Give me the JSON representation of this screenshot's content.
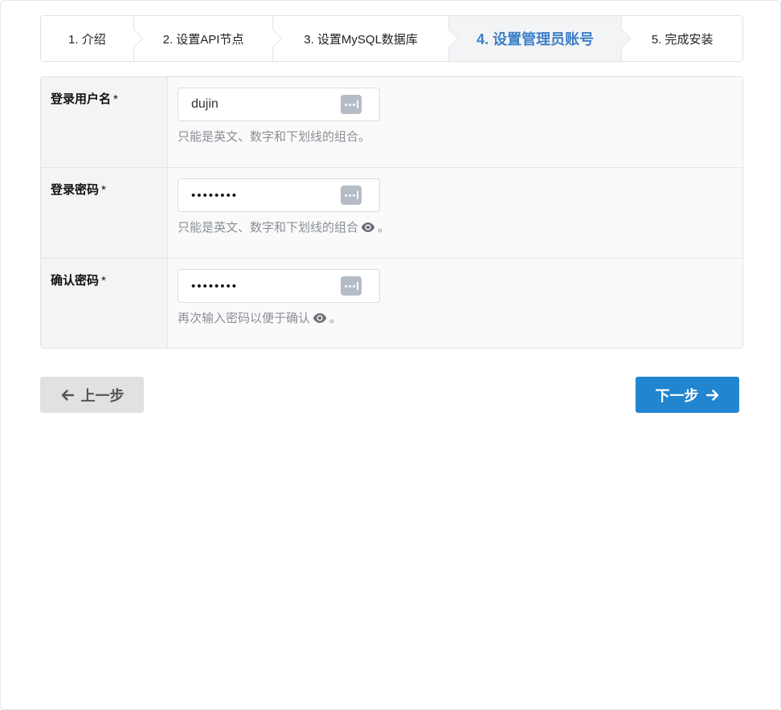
{
  "steps": [
    {
      "label": "1. 介绍"
    },
    {
      "label": "2. 设置API节点"
    },
    {
      "label": "3. 设置MySQL数据库"
    },
    {
      "label": "4. 设置管理员账号"
    },
    {
      "label": "5. 完成安装"
    }
  ],
  "active_step": 4,
  "form": {
    "username": {
      "label": "登录用户名",
      "required_mark": "*",
      "value": "dujin",
      "hint": "只能是英文、数字和下划线的组合。"
    },
    "password": {
      "label": "登录密码",
      "required_mark": "*",
      "value": "••••••••",
      "hint": "只能是英文、数字和下划线的组合",
      "hint_suffix": "。"
    },
    "confirm": {
      "label": "确认密码",
      "required_mark": "*",
      "value": "••••••••",
      "hint": "再次输入密码以便于确认",
      "hint_suffix": "。"
    }
  },
  "buttons": {
    "prev_label": "上一步",
    "next_label": "下一步"
  },
  "colors": {
    "accent": "#2185d0",
    "active_step_text": "#3d7fc6",
    "hint_text": "#8a8f96"
  },
  "icons": {
    "key": "password-manager-icon",
    "eye": "eye-icon",
    "arrow_left": "arrow-left-icon",
    "arrow_right": "arrow-right-icon"
  }
}
